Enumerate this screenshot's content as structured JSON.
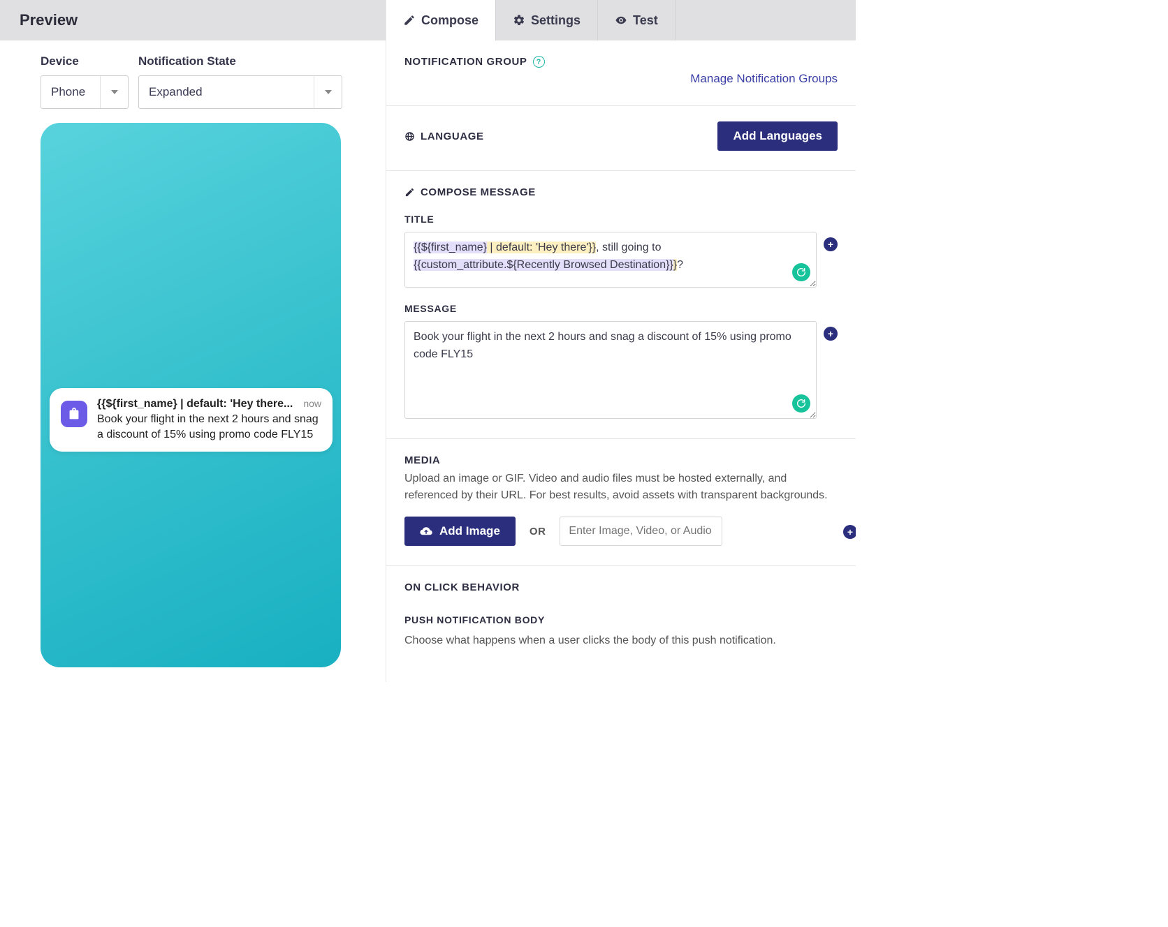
{
  "left": {
    "header": "Preview",
    "device_label": "Device",
    "device_value": "Phone",
    "state_label": "Notification State",
    "state_value": "Expanded"
  },
  "notification": {
    "title": "{{${first_name} | default: 'Hey there...",
    "time": "now",
    "message": "Book your flight in the next 2 hours and snag a discount of 15% using promo code FLY15"
  },
  "tabs": {
    "compose": "Compose",
    "settings": "Settings",
    "test": "Test"
  },
  "sections": {
    "group_label": "NOTIFICATION GROUP",
    "manage_link": "Manage Notification Groups",
    "language_label": "LANGUAGE",
    "add_lang_btn": "Add Languages",
    "compose_label": "COMPOSE MESSAGE",
    "title_label": "TITLE",
    "title_parts": {
      "p1": "{{${first_name}",
      "p2": " | default: 'Hey there'}}",
      "p3": ", still going to ",
      "p4": "{{custom_attribute.${Recently Browsed Destination}}",
      "p5": "}",
      "p6": "?"
    },
    "message_label": "MESSAGE",
    "message_value": "Book your flight in the next 2 hours and snag a discount of 15% using promo code FLY15",
    "media_label": "MEDIA",
    "media_desc": "Upload an image or GIF. Video and audio files must be hosted externally, and referenced by their URL. For best results, avoid assets with transparent backgrounds.",
    "add_image_btn": "Add Image",
    "or": "OR",
    "url_placeholder": "Enter Image, Video, or Audio URL",
    "onclick_label": "ON CLICK BEHAVIOR",
    "body_label": "PUSH NOTIFICATION BODY",
    "body_desc": "Choose what happens when a user clicks the body of this push notification."
  }
}
